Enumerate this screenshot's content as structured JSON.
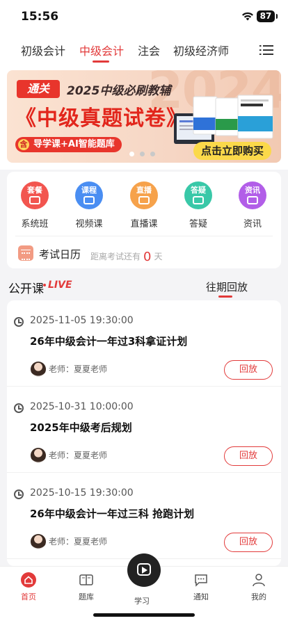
{
  "status": {
    "time": "15:56",
    "battery": "87"
  },
  "tabs": [
    {
      "label": "初级会计"
    },
    {
      "label": "中级会计"
    },
    {
      "label": "注会"
    },
    {
      "label": "初级经济师"
    }
  ],
  "banner": {
    "tag": "通关",
    "headline": "2025中级必刷教辅",
    "title": "《中级真题试卷》",
    "pill_icon": "含",
    "pill": "导学课+AI智能题库",
    "buy": "点击立即购买",
    "watermark": "2024",
    "active_slide": 1,
    "slides": 3
  },
  "quick_nav": [
    {
      "icon": "套餐",
      "label": "系统班",
      "color": "#f2554f"
    },
    {
      "icon": "课程",
      "label": "视频课",
      "color": "#4a8ef2"
    },
    {
      "icon": "直播",
      "label": "直播课",
      "color": "#f6a24b"
    },
    {
      "icon": "答疑",
      "label": "答疑",
      "color": "#39c8a8"
    },
    {
      "icon": "资讯",
      "label": "资讯",
      "color": "#b25ee8"
    }
  ],
  "exam_calendar": {
    "label": "考试日历",
    "prefix": "距离考试还有",
    "days": "0",
    "unit": "天"
  },
  "section": {
    "title": "公开课",
    "live": "LIVE",
    "replay_tab": "往期回放"
  },
  "lessons": [
    {
      "when": "2025-11-05 19:30:00",
      "title": "26年中级会计一年过3科拿证计划",
      "teacher": "老师：夏夏老师",
      "action": "回放"
    },
    {
      "when": "2025-10-31 10:00:00",
      "title": "2025年中级考后规划",
      "teacher": "老师：夏夏老师",
      "action": "回放"
    },
    {
      "when": "2025-10-15 19:30:00",
      "title": "26年中级会计一年过三科 抢跑计划",
      "teacher": "老师：夏夏老师",
      "action": "回放"
    }
  ],
  "tabbar": [
    {
      "label": "首页"
    },
    {
      "label": "题库"
    },
    {
      "label": "学习"
    },
    {
      "label": "通知"
    },
    {
      "label": "我的"
    }
  ],
  "colors": {
    "accent": "#e23a3a"
  }
}
